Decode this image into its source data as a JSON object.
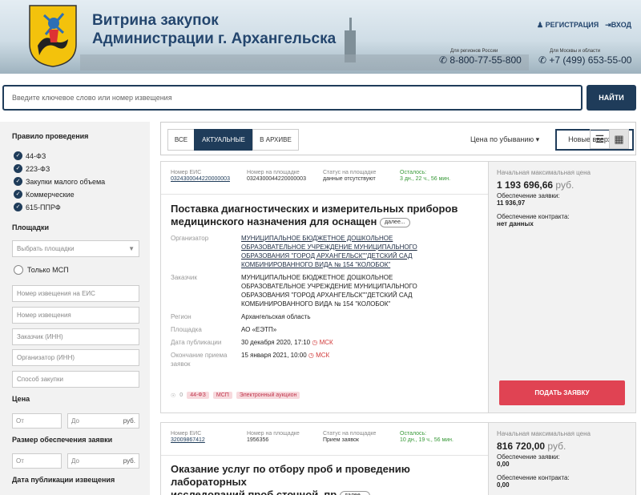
{
  "header": {
    "title_line1": "Витрина закупок",
    "title_line2": "Администрации г. Архангельска",
    "register": "РЕГИСТРАЦИЯ",
    "login": "ВХОД",
    "phone_regions_caption": "Для регионов России",
    "phone_regions": "8-800-77-55-800",
    "phone_moscow_caption": "Для Москвы и области",
    "phone_moscow": "+7 (499) 653-55-00"
  },
  "search": {
    "placeholder": "Введите ключевое слово или номер извещения",
    "button": "НАЙТИ"
  },
  "sidebar": {
    "rule_heading": "Правило проведения",
    "laws": [
      "44-ФЗ",
      "223-ФЗ",
      "Закупки малого объема",
      "Коммерческие",
      "615-ППРФ"
    ],
    "platforms_heading": "Площадки",
    "platforms_placeholder": "Выбрать площадки",
    "only_msp": "Только МСП",
    "fields": [
      "Номер извещения на ЕИС",
      "Номер извещения",
      "Заказчик (ИНН)",
      "Организатор (ИНН)",
      "Способ закупки"
    ],
    "price_heading": "Цена",
    "from": "От",
    "to": "До",
    "currency": "руб.",
    "deposit_heading": "Размер обеспечения заявки",
    "date_heading": "Дата публикации извещения"
  },
  "toolbar": {
    "tab_all": "ВСЕ",
    "tab_current": "АКТУАЛЬНЫЕ",
    "tab_archive": "В АРХИВЕ",
    "sort_price": "Цена по убыванию ▾",
    "sort_new": "Новые вверху ▾",
    "active_tab": "АКТУАЛЬНЫЕ"
  },
  "labels": {
    "eis_number": "Номер ЕИС",
    "platform_number": "Номер на площадке",
    "platform_status": "Статус на площадке",
    "remaining": "Осталось:",
    "organizer": "Организатор",
    "customer": "Заказчик",
    "region": "Регион",
    "platform": "Площадка",
    "pub_date": "Дата публикации",
    "end_date_1": "Окончание приема",
    "end_date_2": "заявок",
    "nmc": "Начальная максимальная цена",
    "bid_security": "Обеспечение заявки:",
    "contract_security": "Обеспечение контракта:",
    "more": "далее...",
    "apply": "ПОДАТЬ ЗАЯВКУ",
    "msk": "МСК",
    "currency": "руб."
  },
  "cards": [
    {
      "eis": "0324300044220000003",
      "platform_no": "0324300044220000003",
      "status": "данные отсутствуют",
      "remaining": "3 дн., 22 ч., 56 мин.",
      "title_1": "Поставка диагностических и измерительных приборов",
      "title_2": "медицинского назначения для оснащен",
      "organizer_1": "МУНИЦИПАЛЬНОЕ БЮДЖЕТНОЕ ДОШКОЛЬНОЕ",
      "organizer_2": "ОБРАЗОВАТЕЛЬНОЕ УЧРЕЖДЕНИЕ МУНИЦИПАЛЬНОГО",
      "organizer_3": "ОБРАЗОВАНИЯ \"ГОРОД АРХАНГЕЛЬСК\"\"ДЕТСКИЙ САД",
      "organizer_4": "КОМБИНИРОВАННОГО ВИДА № 154 \"КОЛОБОК\"",
      "customer_1": "МУНИЦИПАЛЬНОЕ БЮДЖЕТНОЕ ДОШКОЛЬНОЕ",
      "customer_2": "ОБРАЗОВАТЕЛЬНОЕ УЧРЕЖДЕНИЕ МУНИЦИПАЛЬНОГО",
      "customer_3": "ОБРАЗОВАНИЯ \"ГОРОД АРХАНГЕЛЬСК\"\"ДЕТСКИЙ САД",
      "customer_4": "КОМБИНИРОВАННОГО ВИДА № 154 \"КОЛОБОК\"",
      "region": "Архангельская область",
      "platform": "АО «ЕЭТП»",
      "pub_date": "30 декабря 2020, 17:10",
      "end_date": "15 января 2021, 10:00",
      "views": "0",
      "tags": [
        "44-ФЗ",
        "МСП",
        "Электронный аукцион"
      ],
      "price": "1 193 696,66",
      "bid_security": "11 936,97",
      "contract_security": "нет данных"
    },
    {
      "eis": "32009867412",
      "platform_no": "1956356",
      "status": "Прием заявок",
      "remaining": "10 дн., 19 ч., 56 мин.",
      "title_1": "Оказание услуг по отбору проб и проведению лабораторных",
      "title_2": "исследований проб сточной, пр",
      "price": "816 720,00",
      "bid_security": "0,00",
      "contract_security": "0,00"
    }
  ],
  "colors": {
    "accent": "#1f3c5a",
    "danger": "#e04353",
    "tag_bg": "#f7d9dd",
    "green": "#3a9a3a"
  }
}
